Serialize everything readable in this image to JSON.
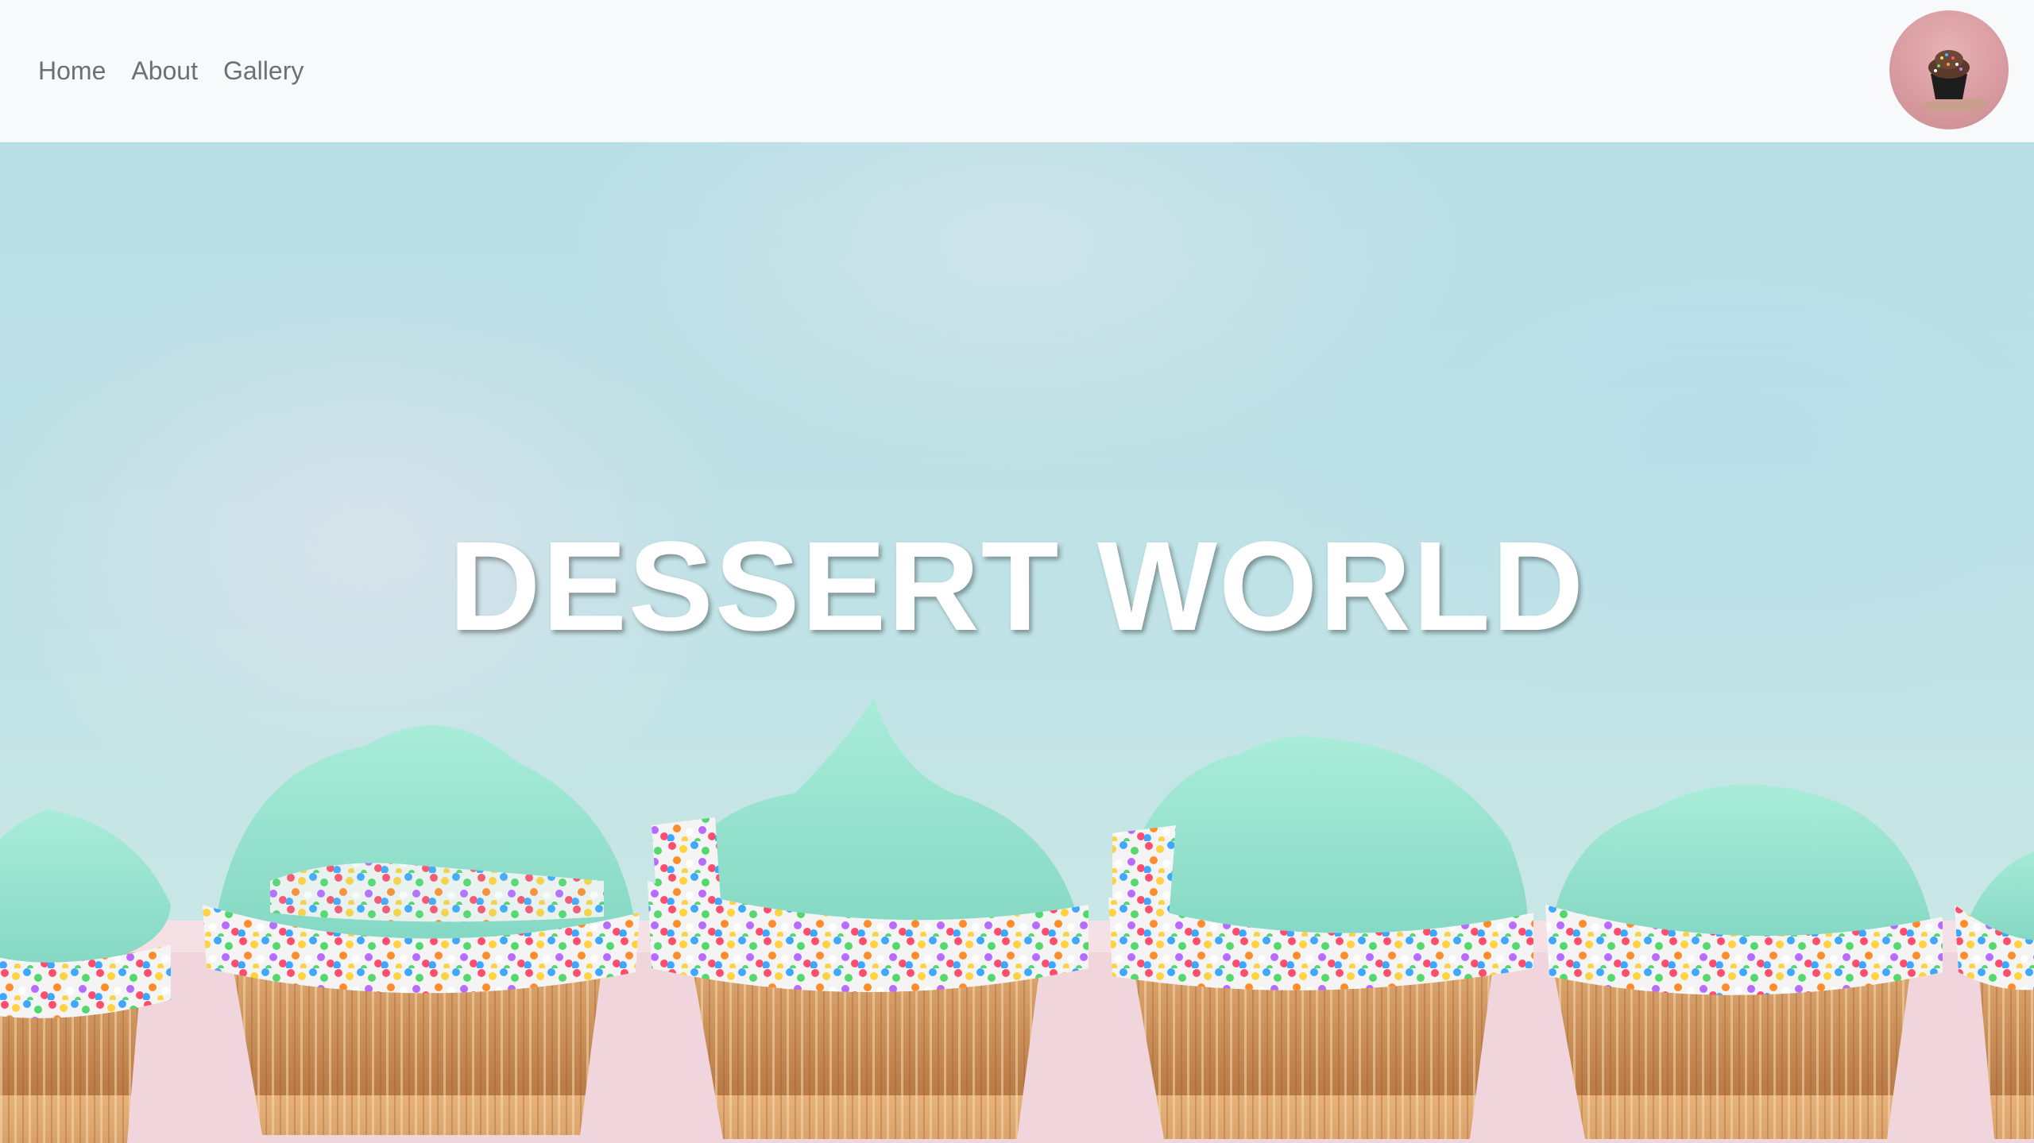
{
  "nav": {
    "links": [
      {
        "label": "Home"
      },
      {
        "label": "About"
      },
      {
        "label": "Gallery"
      }
    ],
    "avatar_icon": "cupcake-avatar-icon"
  },
  "hero": {
    "title": "DESSERT WORLD",
    "image_icon": "cupcakes-photo"
  },
  "colors": {
    "navbar_bg": "#f8f9fa",
    "nav_link": "#6c6f73",
    "hero_sky": "#bfe2e6",
    "frosting": "#9be3d0",
    "wrapper": "#d79a5c",
    "table": "#f2d7dc"
  }
}
